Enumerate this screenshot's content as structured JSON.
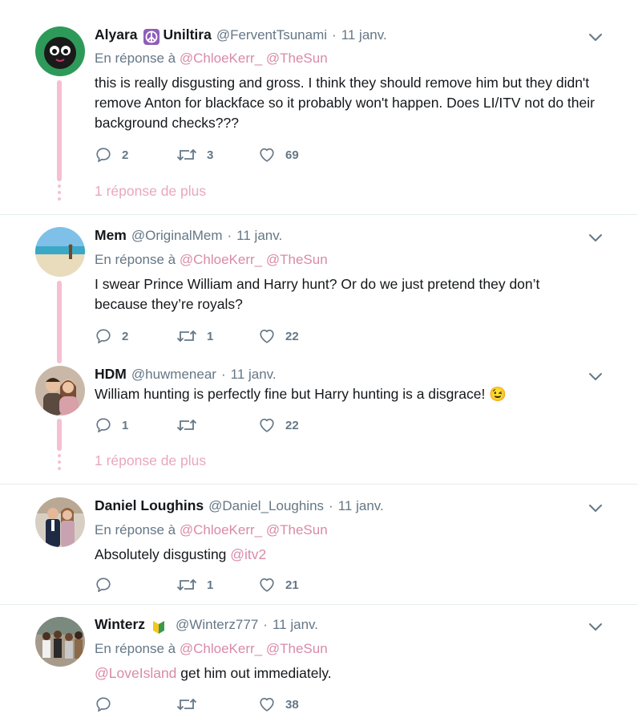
{
  "tweets": [
    {
      "name": "Alyara",
      "name2": "Uniltira",
      "handle": "@FerventTsunami",
      "time": "11 janv.",
      "reply_prefix": "En réponse à",
      "reply_to": [
        "@ChloeKerr_",
        "@TheSun"
      ],
      "text": "this is really disgusting and gross. I think they should remove him but they didn't remove Anton for blackface so it probably won't happen. Does LI/ITV not do their background checks???",
      "replies": "2",
      "retweets": "3",
      "likes": "69",
      "more": "1 réponse de plus"
    },
    {
      "name": "Mem",
      "handle": "@OriginalMem",
      "time": "11 janv.",
      "reply_prefix": "En réponse à",
      "reply_to": [
        "@ChloeKerr_",
        "@TheSun"
      ],
      "text": "I swear Prince William and Harry hunt? Or do we just pretend they don’t because they’re royals?",
      "replies": "2",
      "retweets": "1",
      "likes": "22"
    },
    {
      "name": "HDM",
      "handle": "@huwmenear",
      "time": "11 janv.",
      "text": "William hunting is perfectly fine but Harry hunting is a disgrace! 😉",
      "replies": "1",
      "retweets": "",
      "likes": "22",
      "more": "1 réponse de plus"
    },
    {
      "name": "Daniel Loughins",
      "handle": "@Daniel_Loughins",
      "time": "11 janv.",
      "reply_prefix": "En réponse à",
      "reply_to": [
        "@ChloeKerr_",
        "@TheSun"
      ],
      "text": "Absolutely disgusting",
      "text_mention": "@itv2",
      "replies": "",
      "retweets": "1",
      "likes": "21"
    },
    {
      "name": "Winterz",
      "handle": "@Winterz777",
      "time": "11 janv.",
      "reply_prefix": "En réponse à",
      "reply_to": [
        "@ChloeKerr_",
        "@TheSun"
      ],
      "text_mention": "@LoveIsland",
      "text": "get him out immediately.",
      "replies": "",
      "retweets": "",
      "likes": "38"
    }
  ],
  "icons": {
    "reply": "reply-icon",
    "retweet": "retweet-icon",
    "like": "like-icon",
    "chevron": "chevron-down-icon",
    "peace": "peace-symbol-icon",
    "beginner": "beginner-mark-icon"
  },
  "colors": {
    "name": "#14171a",
    "meta": "#657786",
    "mention": "#d98aa8",
    "thread": "#f5c0d1",
    "divider": "#e6ecf0"
  }
}
